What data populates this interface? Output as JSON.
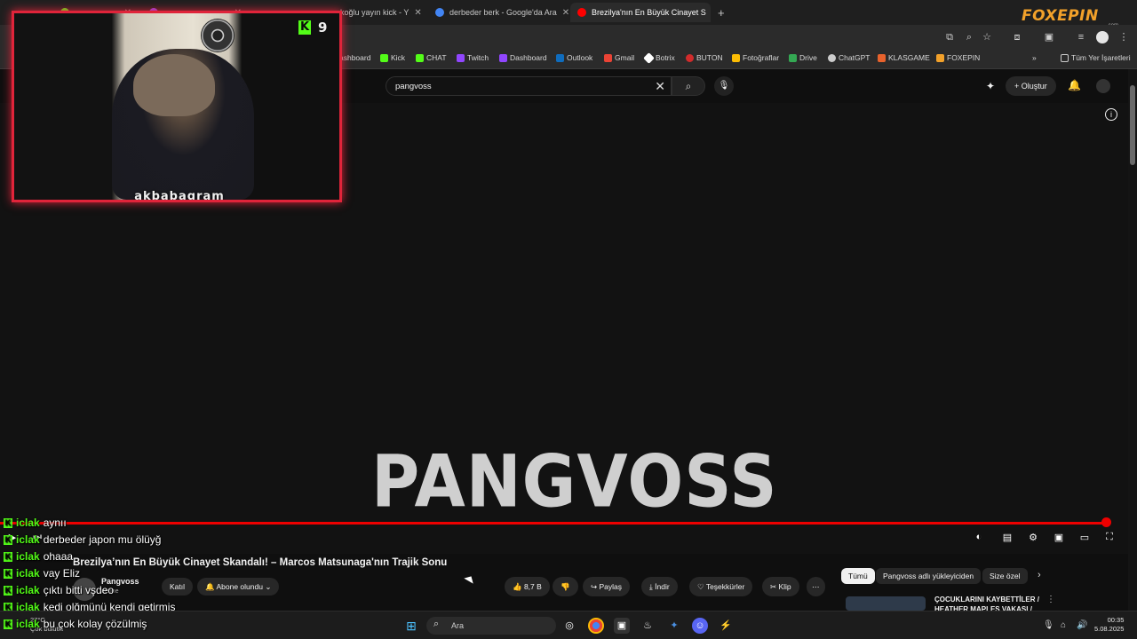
{
  "browser": {
    "tabs": [
      {
        "label": "",
        "active": false
      },
      {
        "label": "",
        "active": false
      },
      {
        "label": "rkoğlu yayın kick - Y",
        "active": false
      },
      {
        "label": "derbeder berk - Google'da Ara",
        "active": false
      },
      {
        "label": "Brezilya'nın En Büyük Cinayet S",
        "active": true
      }
    ],
    "new_tab": "+",
    "bookmarks": [
      {
        "label": "ashboard",
        "color": "#8a8a8a"
      },
      {
        "label": "Kick",
        "color": "#53fc18"
      },
      {
        "label": "CHAT",
        "color": "#53fc18"
      },
      {
        "label": "Twitch",
        "color": "#9146ff"
      },
      {
        "label": "Dashboard",
        "color": "#9146ff"
      },
      {
        "label": "Outlook",
        "color": "#0f6cbd"
      },
      {
        "label": "Gmail",
        "color": "#ea4335"
      },
      {
        "label": "Botrix",
        "color": "#ffffff"
      },
      {
        "label": "BUTON",
        "color": "#d12b2b"
      },
      {
        "label": "Fotoğraflar",
        "color": "#fbbc04"
      },
      {
        "label": "Drive",
        "color": "#34a853"
      },
      {
        "label": "ChatGPT",
        "color": "#cccccc"
      },
      {
        "label": "KLASGAME",
        "color": "#e8622c"
      },
      {
        "label": "FOXEPIN",
        "color": "#f2a12a"
      }
    ],
    "all_bookmarks": "Tüm Yer İşaretleri"
  },
  "youtube": {
    "search_value": "pangvoss",
    "create_label": "Oluştur",
    "video_logo_text": "PANGVOSS",
    "progress": 0.98,
    "title": "Brezilya’nın En Büyük Cinayet Skandalı! – Marcos Matsunaga'nın Trajik Sonu",
    "channel": "Pangvoss",
    "subscribers": "abone",
    "join_label": "Katıl",
    "subscribed_label": "Abone olundu",
    "likes": "8,7 B",
    "share_label": "Paylaş",
    "download_label": "İndir",
    "thanks_label": "Teşekkürler",
    "clip_label": "Klip",
    "more_label": "⋯",
    "chips": [
      "Tümü",
      "Pangvoss adlı yükleyiciden",
      "Size özel"
    ],
    "rec_title": "ÇOCUKLARINI KAYBETTİLER / HEATHER MAPLES VAKASI /"
  },
  "webcam": {
    "name": "akbabagram",
    "viewer_count": "9",
    "k_letter": "K"
  },
  "brand": {
    "logo": "FOXEPIN",
    "sub": ".com"
  },
  "chat": [
    {
      "user": "iclak",
      "message": "aynıı"
    },
    {
      "user": "iclak",
      "message": "derbeder japon mu ölüyğ"
    },
    {
      "user": "iclak",
      "message": "ohaaa"
    },
    {
      "user": "iclak",
      "message": "vay Eliz"
    },
    {
      "user": "iclak",
      "message": "çıktı bitti vşdeo"
    },
    {
      "user": "iclak",
      "message": "kedi olğmünü kendi getirmiş"
    },
    {
      "user": "iclak",
      "message": "bu çok kolay çözülmiş"
    }
  ],
  "taskbar": {
    "search_label": "Ara",
    "weather_temp": "27°C",
    "weather_desc": "Çok bulutlu",
    "time": "00:35",
    "date": "5.08.2025"
  },
  "colors": {
    "kick_green": "#53fc18",
    "overlay_red": "#e0243a",
    "yt_red": "#ff0000",
    "foxepin_orange": "#f2a12a"
  }
}
